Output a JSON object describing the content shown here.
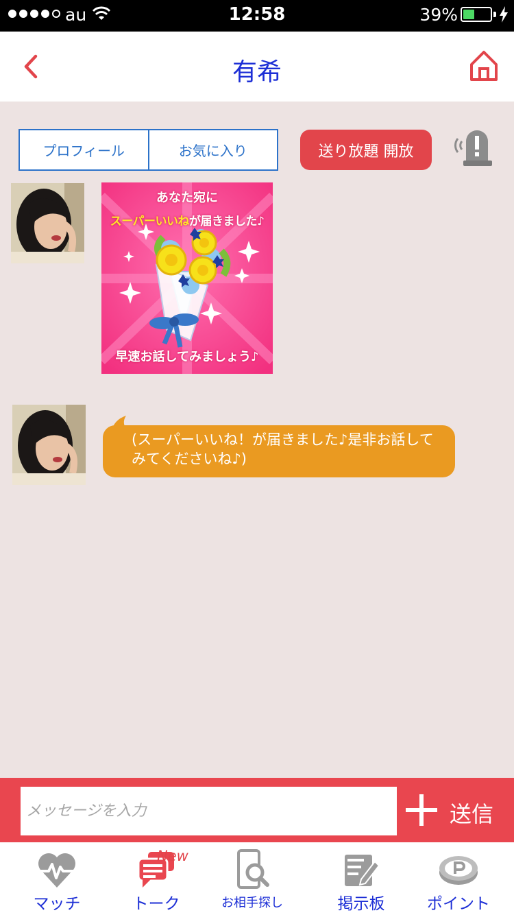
{
  "status_bar": {
    "carrier": "au",
    "time": "12:58",
    "battery": "39%",
    "battery_level": 0.39
  },
  "header": {
    "title": "有希"
  },
  "actions": {
    "profile": "プロフィール",
    "favorite": "お気に入り",
    "unlimited": "送り放題 開放"
  },
  "messages": {
    "stamp": {
      "line1": "あなた宛に",
      "line2_highlight": "スーパーいいね",
      "line2_rest": "が届きました♪",
      "line3": "早速お話してみましょう♪"
    },
    "text": "(スーパーいいね！が届きました♪是非お話してみてくださいね♪)"
  },
  "composer": {
    "placeholder": "メッセージを入力",
    "send": "送信"
  },
  "tabs": [
    {
      "label": "マッチ",
      "icon": "heart-pulse-icon"
    },
    {
      "label": "トーク",
      "icon": "chat-bubble-icon",
      "badge": "New"
    },
    {
      "label": "お相手探し",
      "icon": "phone-search-icon"
    },
    {
      "label": "掲示板",
      "icon": "board-edit-icon"
    },
    {
      "label": "ポイント",
      "icon": "point-coin-icon"
    }
  ],
  "colors": {
    "accent": "#e9464f",
    "title": "#1d2fd6",
    "bubble": "#ea9a21",
    "background": "#ede3e2",
    "segment": "#2c72c9"
  }
}
